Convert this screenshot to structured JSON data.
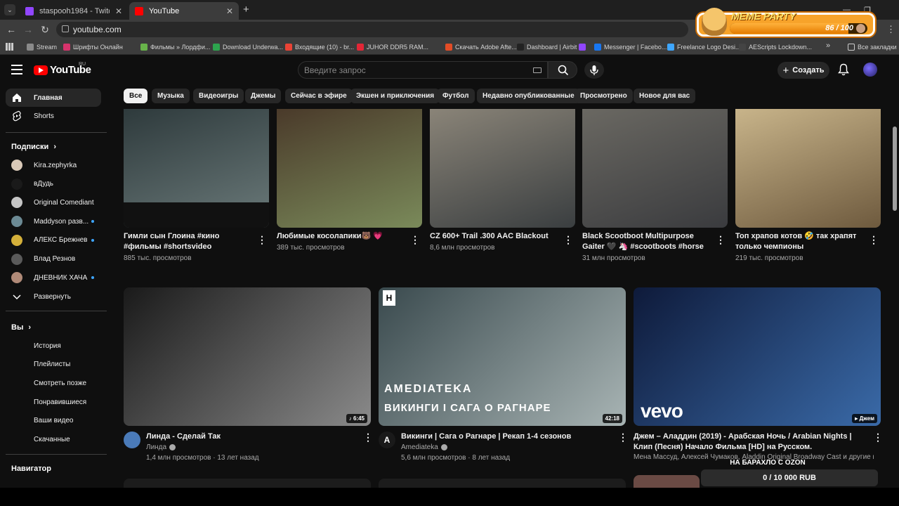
{
  "browser": {
    "tabs": [
      {
        "label": "staspooh1984 - Twitch",
        "favicon_color": "#9146ff",
        "active": false
      },
      {
        "label": "YouTube",
        "favicon_color": "#ff0000",
        "active": true
      }
    ],
    "new_tab": "+",
    "url": "youtube.com",
    "bookmarks": [
      {
        "label": "Stream",
        "color": "#8a8a8a"
      },
      {
        "label": "Шрифты Онлайн",
        "color": "#d6336c"
      },
      {
        "label": "Фильмы » Лордфи...",
        "color": "#68b34a"
      },
      {
        "label": "Download Underwa...",
        "color": "#2da44e"
      },
      {
        "label": "Входящие (10) - br...",
        "color": "#ea4335"
      },
      {
        "label": "JUHOR DDR5 RAM...",
        "color": "#e32636"
      },
      {
        "label": "Скачать Adobe Afte...",
        "color": "#e34c26"
      },
      {
        "label": "Dashboard | Airbit",
        "color": "#222222"
      },
      {
        "label": "",
        "color": "#9146ff"
      },
      {
        "label": "Messenger | Facebo...",
        "color": "#1877f2"
      },
      {
        "label": "Freelance Logo Desi...",
        "color": "#3ea6ff"
      },
      {
        "label": "AEScripts Lockdown...",
        "color": "#444444"
      }
    ],
    "bookmarks_more": "»",
    "all_bookmarks": "Все закладки"
  },
  "overlay": {
    "title": "MEME PARTY",
    "count": "86 / 100",
    "progress": 0.86
  },
  "youtube": {
    "logo": "YouTube",
    "region": "RU",
    "search_placeholder": "Введите запрос",
    "create_label": "Создать",
    "sidebar": {
      "top": [
        {
          "label": "Главная",
          "icon": "home-icon",
          "active": true
        },
        {
          "label": "Shorts",
          "icon": "shorts-icon",
          "active": false
        }
      ],
      "subscriptions_title": "Подписки",
      "subscriptions": [
        {
          "label": "Kira.zephyrka",
          "color": "#d9c9b8",
          "dot": false
        },
        {
          "label": "вДудь",
          "color": "#1a1a1a",
          "dot": false
        },
        {
          "label": "Original Comediant",
          "color": "#c5c5c5",
          "dot": false
        },
        {
          "label": "Maddyson разв...",
          "color": "#6c8a94",
          "dot": true
        },
        {
          "label": "АЛЕКС Брежнев",
          "color": "#d4b03a",
          "dot": true
        },
        {
          "label": "Влад Резнов",
          "color": "#5a5a5a",
          "dot": false
        },
        {
          "label": "ДНЕВНИК ХАЧА",
          "color": "#b08a78",
          "dot": true
        }
      ],
      "expand_label": "Развернуть",
      "you_title": "Вы",
      "you_items": [
        {
          "label": "История",
          "icon": "history-icon"
        },
        {
          "label": "Плейлисты",
          "icon": "playlists-icon"
        },
        {
          "label": "Смотреть позже",
          "icon": "watch-later-icon"
        },
        {
          "label": "Понравившиеся",
          "icon": "like-icon"
        },
        {
          "label": "Ваши видео",
          "icon": "your-videos-icon"
        },
        {
          "label": "Скачанные",
          "icon": "download-icon"
        }
      ],
      "navigator_title": "Навигатор"
    },
    "chips": [
      "Все",
      "Музыка",
      "Видеоигры",
      "Джемы",
      "Сейчас в эфире",
      "Экшен и приключения",
      "Футбол",
      "Недавно опубликованные",
      "Просмотрено",
      "Новое для вас"
    ],
    "shorts": [
      {
        "title": "Гимли сын Глоина  #кино  #фильмы #shortsvideo #lordoftherings",
        "views": "885 тыс. просмотров",
        "colors": [
          "#2e3a3c",
          "#6b7a7a"
        ]
      },
      {
        "title": "Любимые косолапики🐻 💗",
        "views": "389 тыс. просмотров",
        "colors": [
          "#4a3a2a",
          "#7a8a5a"
        ]
      },
      {
        "title": "CZ 600+ Trail .300 AAC Blackout",
        "views": "8,6 млн просмотров",
        "colors": [
          "#8a8478",
          "#3a3e40"
        ]
      },
      {
        "title": "Black Scootboot Multipurpose Gaiter 🖤 🦄 #scootboots #horse ...",
        "views": "31 млн просмотров",
        "colors": [
          "#6a6862",
          "#3a3b3e"
        ]
      },
      {
        "title": "Топ храпов котов 🤣 так храпят только чемпионы",
        "views": "219 тыс. просмотров",
        "colors": [
          "#c8b48a",
          "#6e5a3e"
        ]
      }
    ],
    "videos": [
      {
        "title": "Линда - Сделай Так",
        "channel": "Линда",
        "meta": "1,4 млн просмотров · 13 лет назад",
        "duration": "♪ 6:45",
        "colors": [
          "#1a1a1a",
          "#8a8a8a"
        ],
        "avatar": "#4a7ab8",
        "brand": "",
        "overlay_text": ""
      },
      {
        "title": "Викинги | Сага о Рагнаре | Рекап 1-4 сезонов",
        "channel": "Amediateka",
        "meta": "5,6 млн просмотров · 8 лет назад",
        "duration": "42:18",
        "colors": [
          "#3a4a4e",
          "#a8b4b4"
        ],
        "avatar": "#1a1a1a",
        "brand": "AMEDIATEKA",
        "overlay_text": "ВИКИНГИ I САГА О РАГНАРЕ"
      },
      {
        "title": "Джем – Аладдин (2019) - Арабская Ночь / Arabian Nights | Клип (Песня) Начало Фильма [HD] на Русском.",
        "channel": "Мена Массуд, Алексей Чумаков, Aladdin Original Broadway Cast и другие испол...",
        "meta": "",
        "duration": "▸ Джем",
        "colors": [
          "#0e1a3a",
          "#3a6aa8"
        ],
        "avatar": "",
        "brand": "vevo",
        "overlay_text": ""
      }
    ],
    "ozon": {
      "label": "НА БАРАХЛО С OZON",
      "value": "0 / 10 000 RUB"
    }
  }
}
